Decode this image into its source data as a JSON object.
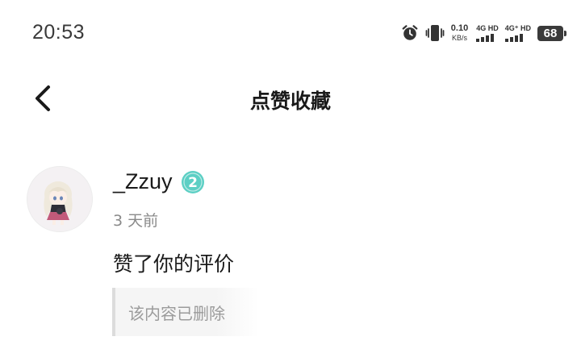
{
  "status_bar": {
    "time": "20:53",
    "net_speed_value": "0.10",
    "net_speed_unit": "KB/s",
    "sim1_label": "4G HD",
    "sim2_label": "4G⁺ HD",
    "battery": "68",
    "icons": [
      "alarm-icon",
      "vibrate-icon"
    ]
  },
  "nav": {
    "back_icon": "chevron-left-icon",
    "title": "点赞收藏"
  },
  "notification": {
    "username": "_Zzuy",
    "level_badge": "2",
    "level_badge_color": "#5ccfc4",
    "time_ago": "3 天前",
    "action": "赞了你的评价",
    "quoted_content": "该内容已删除"
  }
}
